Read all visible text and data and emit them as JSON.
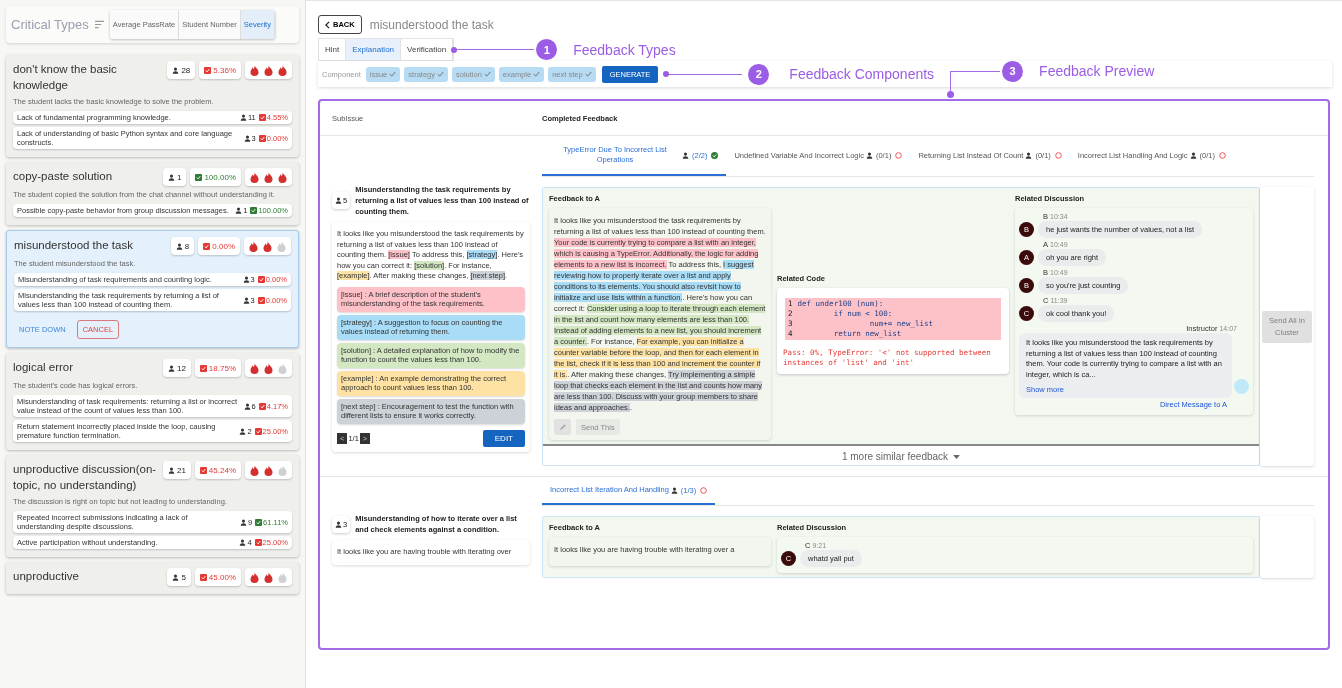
{
  "sidebar": {
    "title": "Critical Types",
    "sort_options": [
      {
        "label": "Average PassRate",
        "selected": false
      },
      {
        "label": "Student Number",
        "selected": false
      },
      {
        "label": "Severity",
        "selected": true
      }
    ],
    "cards": [
      {
        "title": "don't know the basic knowledge",
        "students": "28",
        "pass_rate": "5.36%",
        "color": "#e53935",
        "stars": 3,
        "selected": false,
        "description": "The student lacks the basic knowledge to solve the problem.",
        "subissues": [
          {
            "text": "Lack of fundamental programming knowledge.",
            "students": "11",
            "pass_rate": "4.55%",
            "color": "#e53935"
          },
          {
            "text": "Lack of understanding of basic Python syntax and core language constructs.",
            "students": "3",
            "pass_rate": "0.00%",
            "color": "#e53935"
          }
        ]
      },
      {
        "title": "copy-paste solution",
        "students": "1",
        "pass_rate": "100.00%",
        "color": "#2e7d32",
        "stars": 3,
        "selected": false,
        "description": "The student copied the solution from the chat channel without understanding it.",
        "subissues": [
          {
            "text": "Possible copy-paste behavior from group discussion messages.",
            "students": "1",
            "pass_rate": "100.00%",
            "color": "#2e7d32"
          }
        ]
      },
      {
        "title": "misunderstood the task",
        "students": "8",
        "pass_rate": "0.00%",
        "color": "#e53935",
        "stars": 2,
        "selected": true,
        "description": "The student misunderstood the task.",
        "subissues": [
          {
            "text": "Misunderstanding of task requirements and counting logic.",
            "students": "3",
            "pass_rate": "0.00%",
            "color": "#e53935"
          },
          {
            "text": "Misunderstanding the task requirements by returning a list of values less than 100 instead of counting them.",
            "students": "3",
            "pass_rate": "0.00%",
            "color": "#e53935"
          }
        ],
        "actions": [
          {
            "label": "NOTE DOWN",
            "kind": "text"
          },
          {
            "label": "CANCEL",
            "kind": "outlined"
          }
        ]
      },
      {
        "title": "logical error",
        "students": "12",
        "pass_rate": "18.75%",
        "color": "#e53935",
        "stars": 2,
        "selected": false,
        "description": "The student's code has logical errors.",
        "subissues": [
          {
            "text": "Misunderstanding of task requirements: returning a list or incorrect value instead of the count of values less than 100.",
            "students": "6",
            "pass_rate": "4.17%",
            "color": "#e53935"
          },
          {
            "text": "Return statement incorrectly placed inside the loop, causing premature function termination.",
            "students": "2",
            "pass_rate": "25.00%",
            "color": "#e53935"
          }
        ]
      },
      {
        "title": "unproductive discussion(on-topic, no understanding)",
        "students": "21",
        "pass_rate": "45.24%",
        "color": "#e53935",
        "stars": 2,
        "selected": false,
        "description": "The discussion is right on topic but not leading to understanding.",
        "subissues": [
          {
            "text": "Repeated incorrect submissions indicating a lack of understanding despite discussions.",
            "students": "9",
            "pass_rate": "61.11%",
            "color": "#2e7d32"
          },
          {
            "text": "Active participation without understanding.",
            "students": "4",
            "pass_rate": "25.00%",
            "color": "#e53935"
          }
        ]
      },
      {
        "title": "unproductive",
        "students": "5",
        "pass_rate": "45.00%",
        "color": "#e53935",
        "stars": 2,
        "selected": false
      }
    ]
  },
  "header": {
    "back_button": "BACK",
    "title": "misunderstood the task"
  },
  "feedback_types": [
    {
      "label": "Hint",
      "selected": false
    },
    {
      "label": "Explanation",
      "selected": true
    },
    {
      "label": "Verification",
      "selected": false
    }
  ],
  "components": {
    "label": "Component",
    "items": [
      {
        "label": "issue",
        "checked": true
      },
      {
        "label": "strategy",
        "checked": true
      },
      {
        "label": "solution",
        "checked": true
      },
      {
        "label": "example",
        "checked": true
      },
      {
        "label": "next step",
        "checked": true
      }
    ],
    "generate_button": "GENERATE"
  },
  "annotations": [
    {
      "number": "1",
      "label": "Feedback Types"
    },
    {
      "number": "2",
      "label": "Feedback Components"
    },
    {
      "number": "3",
      "label": "Feedback Preview"
    }
  ],
  "preview": {
    "columns": [
      "SubIssue",
      "Completed Feedback"
    ],
    "rows": [
      {
        "subissue": {
          "students": "5",
          "title": "Misunderstanding the task requirements by returning a list of values less than 100 instead of counting them.",
          "template": [
            {
              "text": "It looks like you misunderstood the task requirements by returning a list of values less than 100 instead of counting them. ",
              "kind": "plain"
            },
            {
              "text": "[issue]",
              "kind": "issue"
            },
            {
              "text": " To address this, ",
              "kind": "plain"
            },
            {
              "text": "[strategy]",
              "kind": "strategy"
            },
            {
              "text": ". Here's how you can correct it: ",
              "kind": "plain"
            },
            {
              "text": "[solution]",
              "kind": "solution"
            },
            {
              "text": ". For instance, ",
              "kind": "plain"
            },
            {
              "text": "[example]",
              "kind": "example"
            },
            {
              "text": ". After making these changes, ",
              "kind": "plain"
            },
            {
              "text": "[next step]",
              "kind": "next_step"
            },
            {
              "text": ".",
              "kind": "plain"
            }
          ],
          "component_notes": [
            {
              "kind": "issue",
              "text": "[issue] : A brief description of the student's misunderstanding of the task requirements."
            },
            {
              "kind": "strategy",
              "text": "[strategy] : A suggestion to focus on counting the values instead of returning them."
            },
            {
              "kind": "solution",
              "text": "[solution] : A detailed explanation of how to modify the function to count the values less than 100."
            },
            {
              "kind": "example",
              "text": "[example] : An example demonstrating the correct approach to count values less than 100."
            },
            {
              "kind": "next_step",
              "text": "[next step] : Encouragement to test the function with different lists to ensure it works correctly."
            }
          ],
          "pager": {
            "prev": "<",
            "page": "1/1",
            "next": ">"
          },
          "edit_button": "EDIT"
        },
        "clusters": [
          {
            "label": "TypeError Due To Incorrect List Operations",
            "students": "(2/2)",
            "done": true,
            "selected": true
          },
          {
            "label": "Undefined Variable And Incorrect Logic",
            "students": "(0/1)",
            "done": false,
            "selected": false
          },
          {
            "label": "Returning List Instead Of Count",
            "students": "(0/1)",
            "done": false,
            "selected": false
          },
          {
            "label": "Incorrect List Handling And Logic",
            "students": "(0/1)",
            "done": false,
            "selected": false
          }
        ],
        "feedback": {
          "title": "Feedback to A",
          "segments": [
            {
              "text": "It looks like you misunderstood the task requirements by returning a list of values less than 100 instead of counting them. ",
              "kind": "plain"
            },
            {
              "text": "Your code is currently trying to compare a list with an integer, which is causing a TypeError. Additionally, the logic for adding elements to a new list is incorrect.",
              "kind": "issue"
            },
            {
              "text": " To address this, ",
              "kind": "plain"
            },
            {
              "text": "I suggest reviewing how to properly iterate over a list and apply conditions to its elements. You should also revisit how to initialize and use lists within a function.",
              "kind": "strategy"
            },
            {
              "text": ". Here's how you can correct it: ",
              "kind": "plain"
            },
            {
              "text": "Consider using a loop to iterate through each element in the list and count how many elements are less than 100. Instead of adding elements to a new list, you should increment a counter.",
              "kind": "solution"
            },
            {
              "text": ". For instance, ",
              "kind": "plain"
            },
            {
              "text": "For example, you can initialize a counter variable before the loop, and then for each element in the list, check if it is less than 100 and increment the counter if it is.",
              "kind": "example"
            },
            {
              "text": ". After making these changes, ",
              "kind": "plain"
            },
            {
              "text": "Try implementing a simple loop that checks each element in the list and counts how many are less than 100. Discuss with your group members to share ideas and approaches.",
              "kind": "next_step"
            },
            {
              "text": ".",
              "kind": "plain"
            }
          ],
          "send_button": {
            "label": "Send This",
            "disabled": true
          },
          "code": {
            "title": "Related Code",
            "failed": true,
            "lines": [
              {
                "number": "1",
                "text": "def under100 (num):"
              },
              {
                "number": "2",
                "text": "        if num < 100:"
              },
              {
                "number": "3",
                "text": "                num+= new_list"
              },
              {
                "number": "4",
                "text": "        return new_list"
              }
            ],
            "error": "Pass: 0%, TypeError: '<' not supported between instances of 'list' and 'int'"
          },
          "discussion": {
            "title": "Related Discussion",
            "messages": [
              {
                "kind": "student",
                "sender": "B",
                "avatar": "B",
                "time": "10:34",
                "text": "he just wants the number of values, not a list"
              },
              {
                "kind": "student",
                "sender": "A",
                "avatar": "A",
                "time": "10:49",
                "text": "oh you are right"
              },
              {
                "kind": "student",
                "sender": "B",
                "avatar": "B",
                "time": "10:49",
                "text": "so you're just counting"
              },
              {
                "kind": "student",
                "sender": "C",
                "avatar": "C",
                "time": "11:39",
                "text": "ok cool thank you!"
              },
              {
                "kind": "instructor",
                "sender": "Instructor",
                "time": "14:07",
                "text": "It looks like you misunderstood the task requirements by returning a list of values less than 100 instead of counting them. Your code is currently trying to compare a list with an integer, which is ca...",
                "more": "Show more"
              }
            ],
            "direct_message": "Direct Message to A"
          }
        },
        "more": "1 more similar feedback",
        "cluster_action": {
          "label": "Send All In Cluster",
          "disabled": true
        }
      },
      {
        "subissue": {
          "students": "3",
          "title": "Misunderstanding of how to iterate over a list and check elements against a condition.",
          "template": [
            {
              "text": "It looks like you are having trouble with iterating over",
              "kind": "plain"
            }
          ]
        },
        "clusters": [
          {
            "label": "Incorrect List Iteration And Handling",
            "students": "(1/3)",
            "done": false,
            "selected": true
          }
        ],
        "feedback": {
          "title": "Feedback to A",
          "segments": [
            {
              "text": "It looks like you are having trouble with iterating over a",
              "kind": "plain"
            }
          ],
          "discussion": {
            "title": "Related Discussion",
            "messages": [
              {
                "kind": "student",
                "sender": "C",
                "avatar": "C",
                "time": "9:21",
                "text": "whatd yall put"
              }
            ]
          }
        }
      }
    ]
  }
}
